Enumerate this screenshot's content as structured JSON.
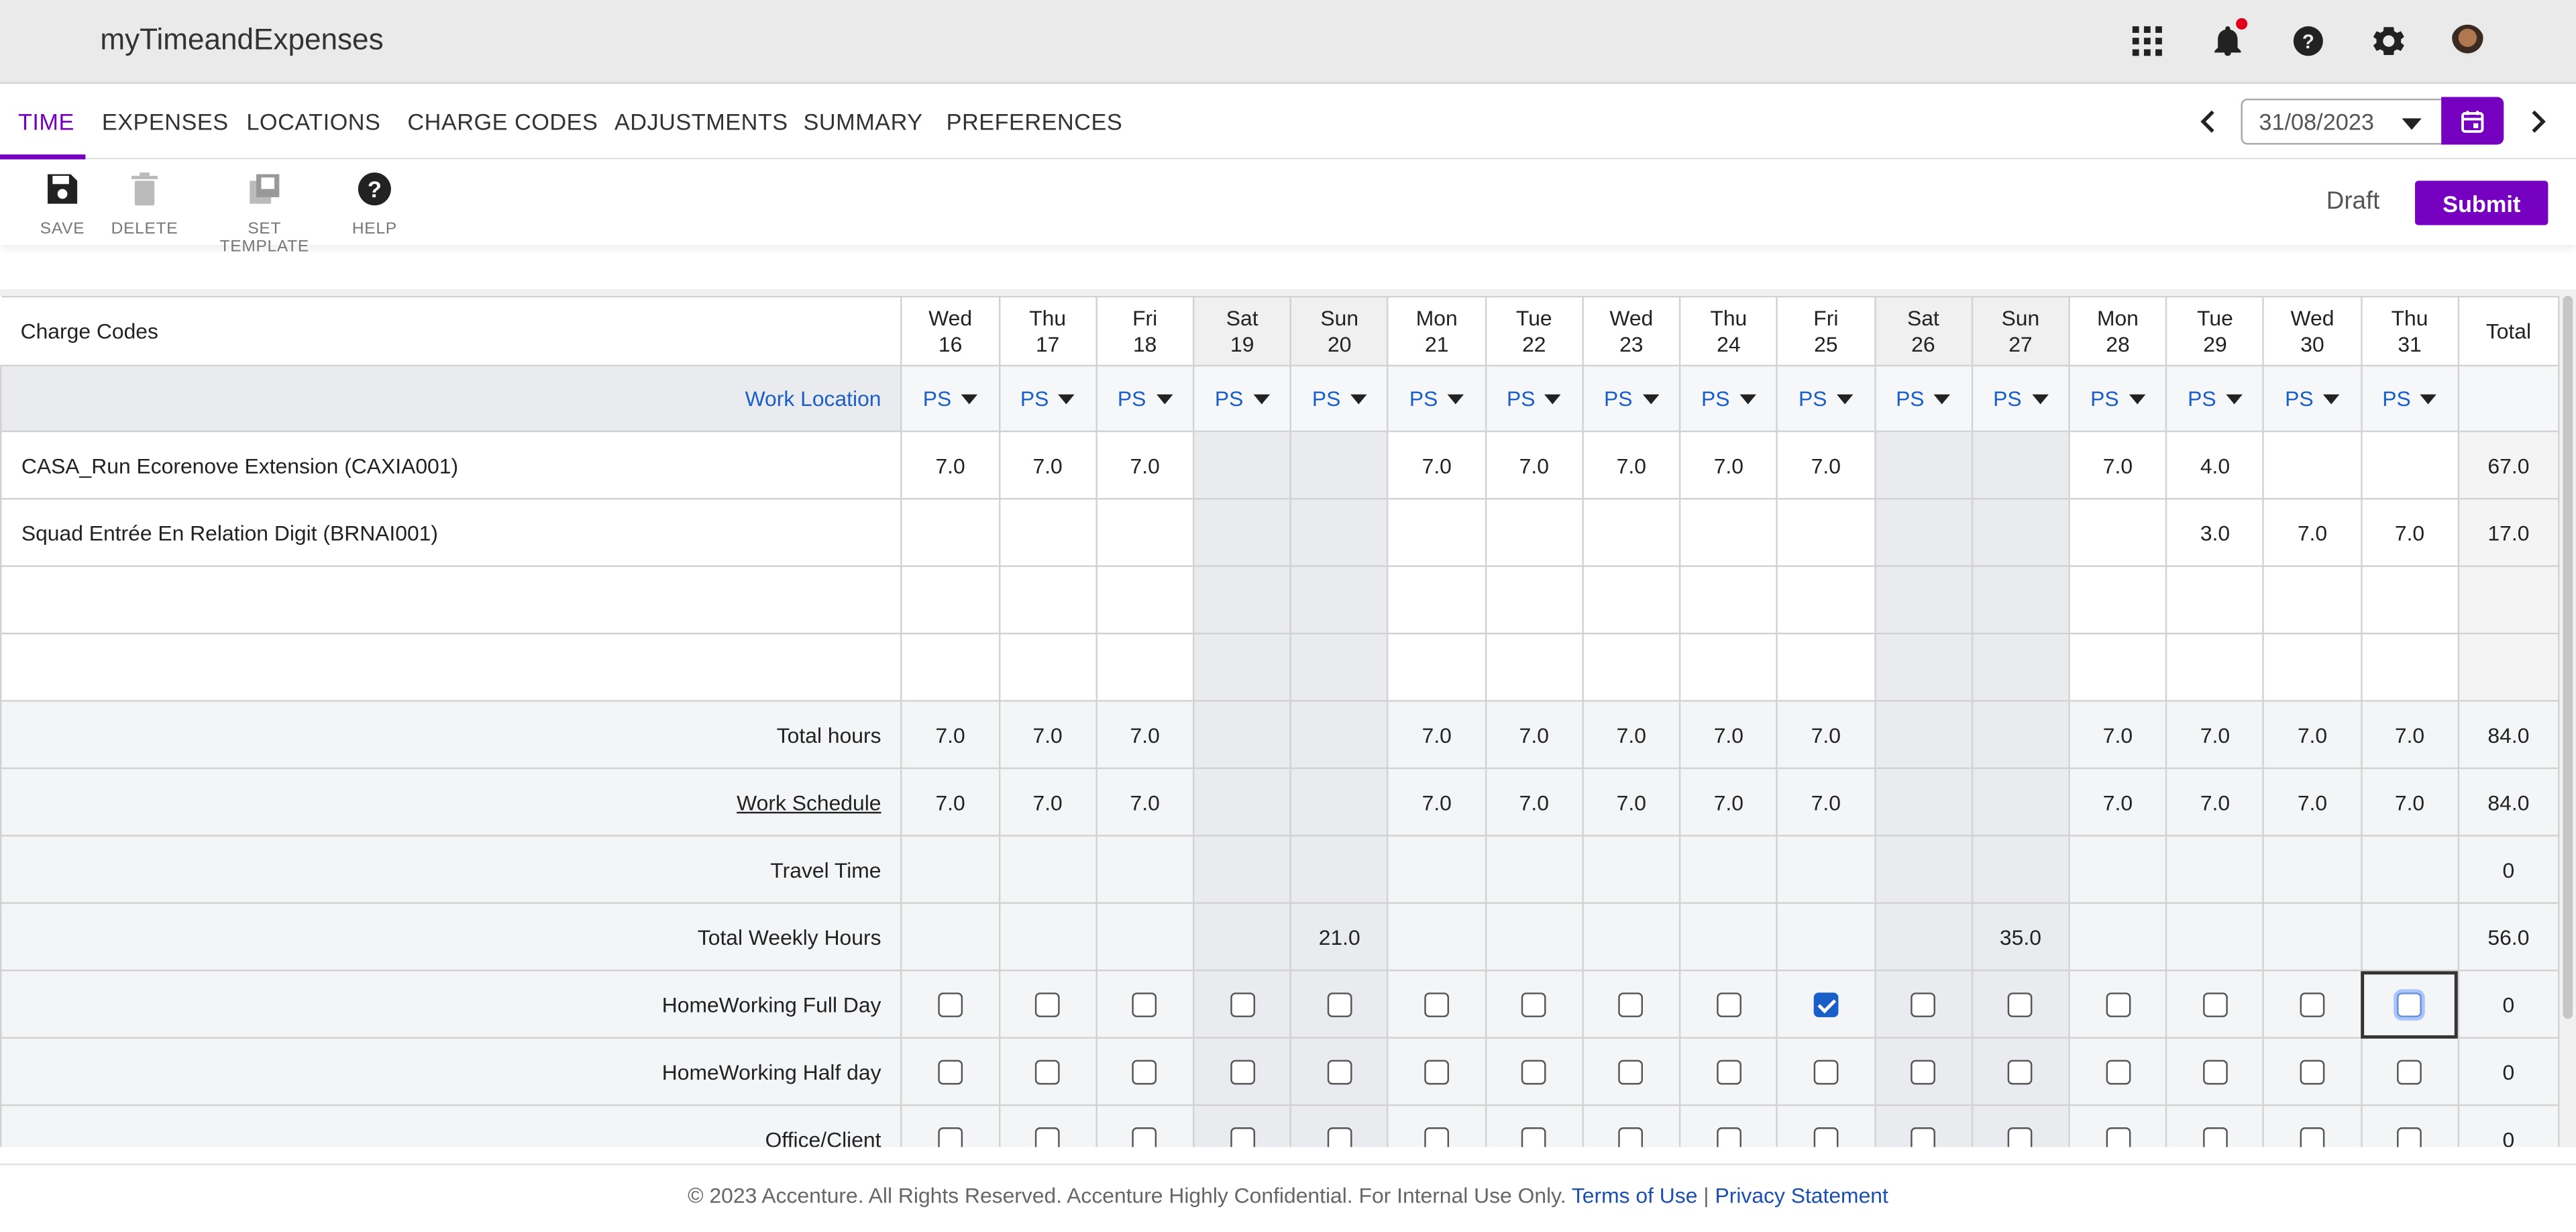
{
  "app": {
    "title": "myTimeandExpenses"
  },
  "tabs": [
    {
      "label": "TIME"
    },
    {
      "label": "EXPENSES"
    },
    {
      "label": "LOCATIONS"
    },
    {
      "label": "CHARGE CODES"
    },
    {
      "label": "ADJUSTMENTS"
    },
    {
      "label": "SUMMARY"
    },
    {
      "label": "PREFERENCES"
    }
  ],
  "date_picker": {
    "value": "31/08/2023"
  },
  "toolbar": {
    "save": "SAVE",
    "delete": "DELETE",
    "set_template": "SET TEMPLATE",
    "help": "HELP"
  },
  "status": "Draft",
  "submit_label": "Submit",
  "grid": {
    "header_label": "Charge Codes",
    "total_label": "Total",
    "days": [
      {
        "dow": "Wed",
        "d": "16",
        "weekend": false
      },
      {
        "dow": "Thu",
        "d": "17",
        "weekend": false
      },
      {
        "dow": "Fri",
        "d": "18",
        "weekend": false
      },
      {
        "dow": "Sat",
        "d": "19",
        "weekend": true
      },
      {
        "dow": "Sun",
        "d": "20",
        "weekend": true
      },
      {
        "dow": "Mon",
        "d": "21",
        "weekend": false
      },
      {
        "dow": "Tue",
        "d": "22",
        "weekend": false
      },
      {
        "dow": "Wed",
        "d": "23",
        "weekend": false
      },
      {
        "dow": "Thu",
        "d": "24",
        "weekend": false
      },
      {
        "dow": "Fri",
        "d": "25",
        "weekend": false
      },
      {
        "dow": "Sat",
        "d": "26",
        "weekend": true
      },
      {
        "dow": "Sun",
        "d": "27",
        "weekend": true
      },
      {
        "dow": "Mon",
        "d": "28",
        "weekend": false
      },
      {
        "dow": "Tue",
        "d": "29",
        "weekend": false
      },
      {
        "dow": "Wed",
        "d": "30",
        "weekend": false
      },
      {
        "dow": "Thu",
        "d": "31",
        "weekend": false
      }
    ],
    "work_location_label": "Work Location",
    "location_value": "PS",
    "charge_rows": [
      {
        "name": "CASA_Run Ecorenove Extension (CAXIA001)",
        "values": [
          "7.0",
          "7.0",
          "7.0",
          "",
          "",
          "7.0",
          "7.0",
          "7.0",
          "7.0",
          "7.0",
          "",
          "",
          "7.0",
          "4.0",
          "",
          ""
        ],
        "total": "67.0"
      },
      {
        "name": "Squad Entrée En Relation Digit (BRNAI001)",
        "values": [
          "",
          "",
          "",
          "",
          "",
          "",
          "",
          "",
          "",
          "",
          "",
          "",
          "",
          "3.0",
          "7.0",
          "7.0"
        ],
        "total": "17.0"
      },
      {
        "name": "",
        "values": [
          "",
          "",
          "",
          "",
          "",
          "",
          "",
          "",
          "",
          "",
          "",
          "",
          "",
          "",
          "",
          ""
        ],
        "total": ""
      },
      {
        "name": "",
        "values": [
          "",
          "",
          "",
          "",
          "",
          "",
          "",
          "",
          "",
          "",
          "",
          "",
          "",
          "",
          "",
          ""
        ],
        "total": ""
      }
    ],
    "total_hours": {
      "label": "Total hours",
      "values": [
        "7.0",
        "7.0",
        "7.0",
        "",
        "",
        "7.0",
        "7.0",
        "7.0",
        "7.0",
        "7.0",
        "",
        "",
        "7.0",
        "7.0",
        "7.0",
        "7.0"
      ],
      "total": "84.0"
    },
    "work_schedule": {
      "label": "Work Schedule",
      "values": [
        "7.0",
        "7.0",
        "7.0",
        "",
        "",
        "7.0",
        "7.0",
        "7.0",
        "7.0",
        "7.0",
        "",
        "",
        "7.0",
        "7.0",
        "7.0",
        "7.0"
      ],
      "total": "84.0"
    },
    "travel_time": {
      "label": "Travel Time",
      "values": [
        "",
        "",
        "",
        "",
        "",
        "",
        "",
        "",
        "",
        "",
        "",
        "",
        "",
        "",
        "",
        ""
      ],
      "total": "0"
    },
    "total_weekly": {
      "label": "Total Weekly Hours",
      "values": [
        "",
        "",
        "",
        "",
        "21.0",
        "",
        "",
        "",
        "",
        "",
        "",
        "35.0",
        "",
        "",
        "",
        ""
      ],
      "total": "56.0"
    },
    "checkbox_rows": [
      {
        "label": "HomeWorking Full Day",
        "checked": [
          false,
          false,
          false,
          false,
          false,
          false,
          false,
          false,
          false,
          true,
          false,
          false,
          false,
          false,
          false,
          false
        ],
        "total": "0"
      },
      {
        "label": "HomeWorking Half day",
        "checked": [
          false,
          false,
          false,
          false,
          false,
          false,
          false,
          false,
          false,
          false,
          false,
          false,
          false,
          false,
          false,
          false
        ],
        "total": "0"
      },
      {
        "label": "Office/Client",
        "checked": [
          false,
          false,
          false,
          false,
          false,
          false,
          false,
          false,
          false,
          false,
          false,
          false,
          false,
          false,
          false,
          false
        ],
        "total": "0"
      }
    ]
  },
  "footer": {
    "copyright": "© 2023 Accenture. All Rights Reserved. Accenture Highly Confidential. For Internal Use Only.",
    "terms": "Terms of Use",
    "separator": "|",
    "privacy": "Privacy Statement"
  }
}
